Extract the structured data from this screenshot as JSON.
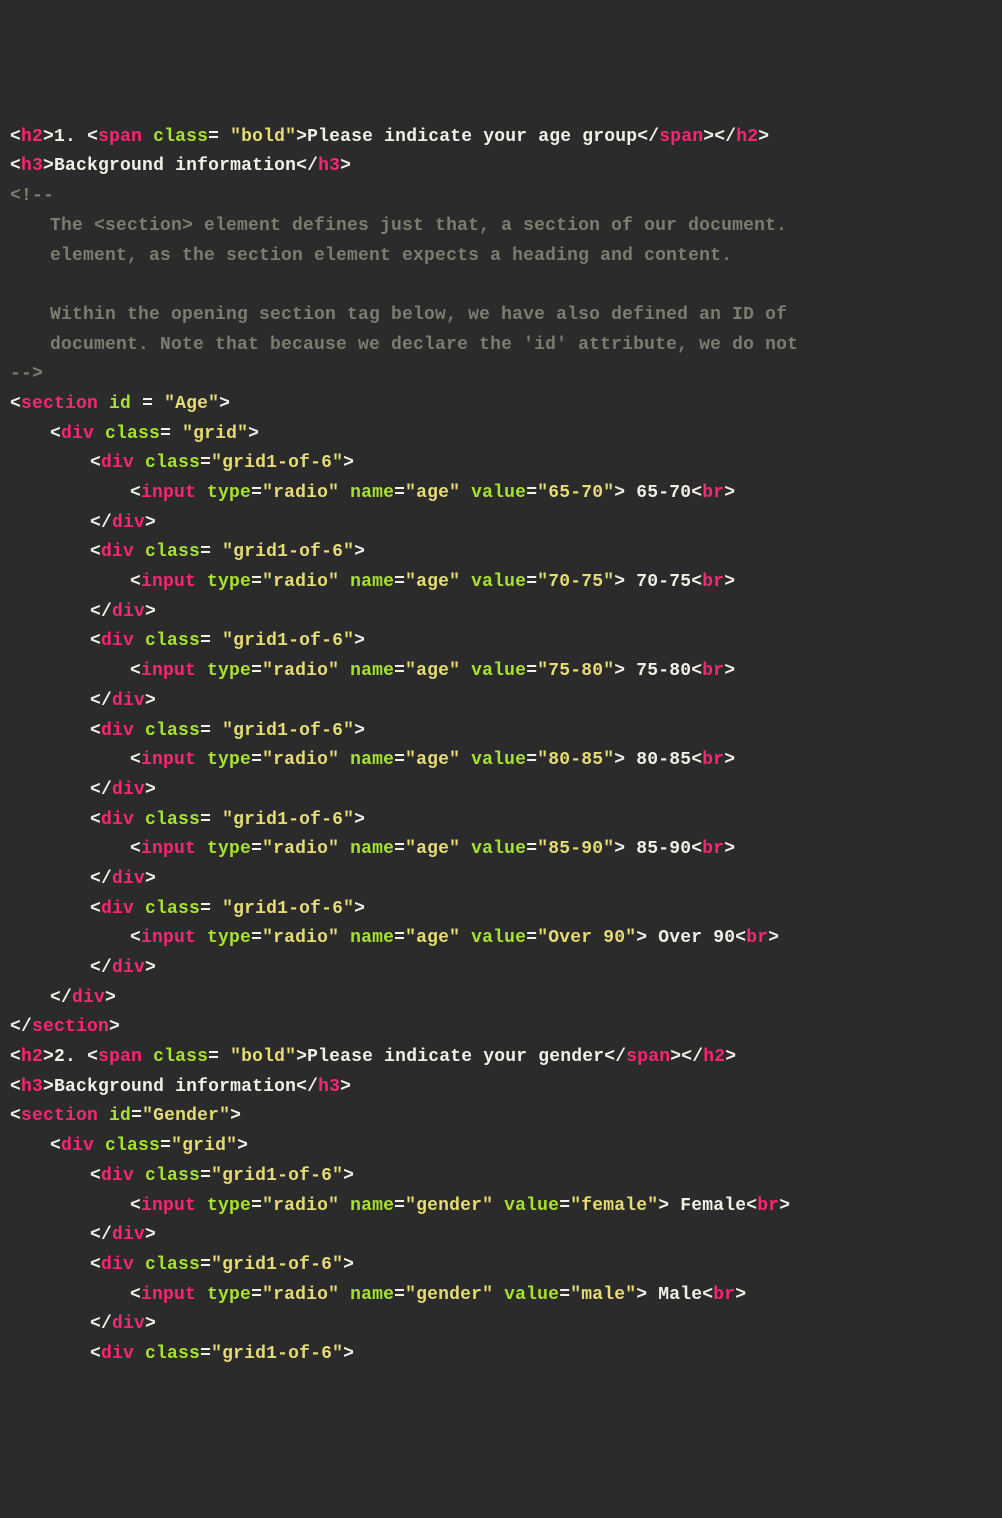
{
  "code": {
    "h2_1_num": "1. ",
    "h2_1_text": "Please indicate your age group",
    "h3_1": "Background information",
    "comment_open": "<!--",
    "comment_l1": "The <section> element defines just that, a section of our document.",
    "comment_l2": "element, as the section element expects a heading and content.",
    "comment_l3": "Within the opening section tag below, we have also defined an ID of",
    "comment_l4": "document. Note that because we declare the 'id' attribute, we do not",
    "comment_close": "-->",
    "h2_2_num": "2. ",
    "h2_2_text": "Please indicate your gender",
    "h3_2": "Background information",
    "tags": {
      "h2": "h2",
      "h3": "h3",
      "span": "span",
      "section": "section",
      "div": "div",
      "input": "input",
      "br": "br"
    },
    "attrs": {
      "class": "class",
      "id": "id",
      "type": "type",
      "name": "name",
      "value": "value"
    },
    "strings": {
      "bold": "\"bold\"",
      "age_id": "\"Age\"",
      "grid": "\"grid\"",
      "grid1of6": "\"grid1-of-6\"",
      "radio": "\"radio\"",
      "name_age": "\"age\"",
      "gender_id": "\"Gender\"",
      "name_gender": "\"gender\""
    },
    "ages": [
      {
        "value": "\"65-70\"",
        "label": " 65-70"
      },
      {
        "value": "\"70-75\"",
        "label": " 70-75"
      },
      {
        "value": "\"75-80\"",
        "label": " 75-80"
      },
      {
        "value": "\"80-85\"",
        "label": " 80-85"
      },
      {
        "value": "\"85-90\"",
        "label": " 85-90"
      },
      {
        "value": "\"Over 90\"",
        "label": " Over 90"
      }
    ],
    "genders": [
      {
        "value": "\"female\"",
        "label": " Female"
      },
      {
        "value": "\"male\"",
        "label": " Male"
      }
    ]
  }
}
